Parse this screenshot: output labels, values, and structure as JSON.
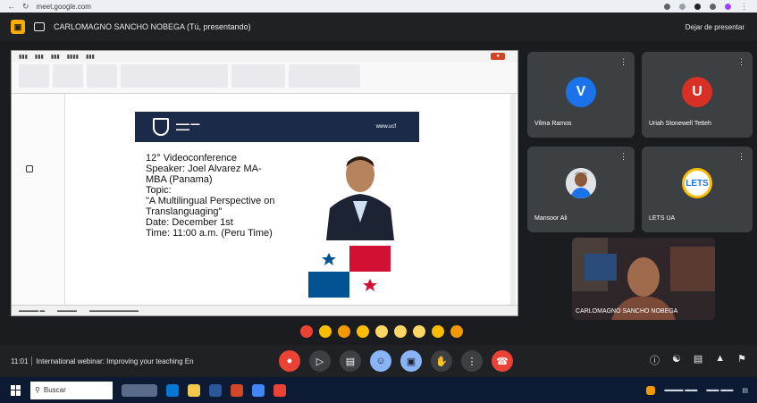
{
  "browser": {
    "url": "meet.google.com"
  },
  "meet": {
    "presenter_label": "CARLOMAGNO SANCHO NOBEGA (Tú, presentando)",
    "stop_label": "Dejar de presentar"
  },
  "slide": {
    "web": "www.ucf",
    "lines": [
      "12° Videoconference",
      "Speaker: Joel Alvarez MA-",
      "MBA (Panama)",
      "Topic:",
      "\"A Multilingual Perspective on",
      "Translanguaging\"",
      "Date: December 1st",
      "Time: 11:00 a.m. (Peru Time)"
    ]
  },
  "participants": [
    {
      "name": "Vilma Ramos",
      "initial": "V",
      "color": "#1a73e8"
    },
    {
      "name": "Uriah Stonewell Tetteh",
      "initial": "U",
      "color": "#d93025"
    },
    {
      "name": "Mansoor Ali",
      "initial": "",
      "color": "#e8eaed"
    },
    {
      "name": "LETS UA",
      "initial": "LETS",
      "color": "#ffffff"
    },
    {
      "name": "CARLOMAGNO SANCHO NOBEGA",
      "initial": "",
      "color": "#5c3b2e"
    }
  ],
  "controls": {
    "time": "11:01",
    "meeting_title": "International webinar: Improving your teaching En"
  },
  "taskbar": {
    "search_placeholder": "Buscar"
  },
  "colors": {
    "meet_bg": "#202124",
    "accent_blue": "#8ab4f8",
    "end_red": "#ea4335"
  }
}
